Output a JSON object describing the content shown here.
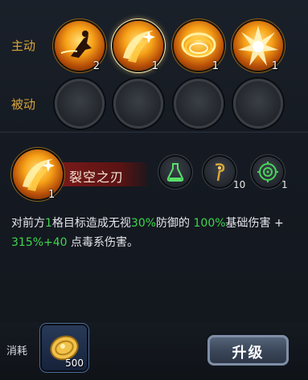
{
  "active": {
    "label": "主动",
    "skills": [
      {
        "icon": "dash-kick-skill-icon",
        "level": "2"
      },
      {
        "icon": "crescent-slash-skill-icon",
        "level": "1"
      },
      {
        "icon": "fire-ring-skill-icon",
        "level": "1"
      },
      {
        "icon": "explosion-burst-skill-icon",
        "level": "1"
      }
    ]
  },
  "passive": {
    "label": "被动"
  },
  "selected": {
    "name": "裂空之刃",
    "level": "1",
    "stats": [
      {
        "icon": "flask-icon",
        "value": ""
      },
      {
        "icon": "staff-icon",
        "value": "10"
      },
      {
        "icon": "target-icon",
        "value": "1"
      }
    ],
    "description": {
      "p1": "对前方",
      "n1": "1",
      "p2": "格目标造成无视",
      "n2": "30%",
      "p3": "防御的 ",
      "n3": "100%",
      "p4": "基础伤害 + ",
      "n4": "315%+40",
      "p5": " 点毒系伤害。"
    }
  },
  "footer": {
    "cost_label": "消耗",
    "cost_value": "500",
    "cost_icon": "gold-coin-icon",
    "upgrade_label": "升级"
  },
  "colors": {
    "label_orange": "#d9a63a",
    "highlight_green": "#3ed64d",
    "name_banner_red": "#7a1a1a"
  }
}
